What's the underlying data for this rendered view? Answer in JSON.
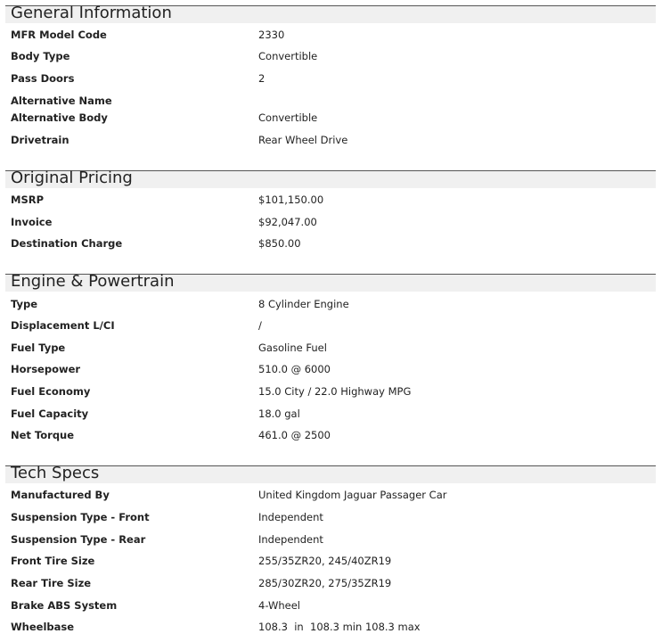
{
  "sections": [
    {
      "title": "General Information",
      "rows": [
        {
          "label": "MFR Model Code",
          "value": "2330"
        },
        {
          "label": "Body Type",
          "value": "Convertible"
        },
        {
          "label": "Pass Doors",
          "value": "2"
        },
        {
          "label": "Alternative Name",
          "value": ""
        },
        {
          "label": "Alternative Body",
          "value": "Convertible"
        },
        {
          "label": "Drivetrain",
          "value": "Rear Wheel Drive"
        }
      ]
    },
    {
      "title": "Original Pricing",
      "rows": [
        {
          "label": "MSRP",
          "value": "$101,150.00"
        },
        {
          "label": "Invoice",
          "value": "$92,047.00"
        },
        {
          "label": "Destination Charge",
          "value": "$850.00"
        }
      ]
    },
    {
      "title": "Engine & Powertrain",
      "rows": [
        {
          "label": "Type",
          "value": "8 Cylinder Engine"
        },
        {
          "label": "Displacement L/CI",
          "value": "/"
        },
        {
          "label": "Fuel Type",
          "value": "Gasoline Fuel"
        },
        {
          "label": "Horsepower",
          "value": "510.0 @ 6000"
        },
        {
          "label": "Fuel Economy",
          "value": "15.0 City / 22.0 Highway MPG"
        },
        {
          "label": "Fuel Capacity",
          "value": "18.0 gal"
        },
        {
          "label": "Net Torque",
          "value": "461.0 @ 2500"
        }
      ]
    },
    {
      "title": "Tech Specs",
      "rows": [
        {
          "label": "Manufactured By",
          "value": "United Kingdom Jaguar Passager Car"
        },
        {
          "label": "Suspension Type - Front",
          "value": "Independent"
        },
        {
          "label": "Suspension Type - Rear",
          "value": "Independent"
        },
        {
          "label": "Front Tire Size",
          "value": "255/35ZR20, 245/40ZR19"
        },
        {
          "label": "Rear Tire Size",
          "value": "285/30ZR20, 275/35ZR19"
        },
        {
          "label": "Brake ABS System",
          "value": "4-Wheel"
        },
        {
          "label": "Wheelbase",
          "value": "108.3  in  108.3 min 108.3 max"
        }
      ]
    }
  ]
}
